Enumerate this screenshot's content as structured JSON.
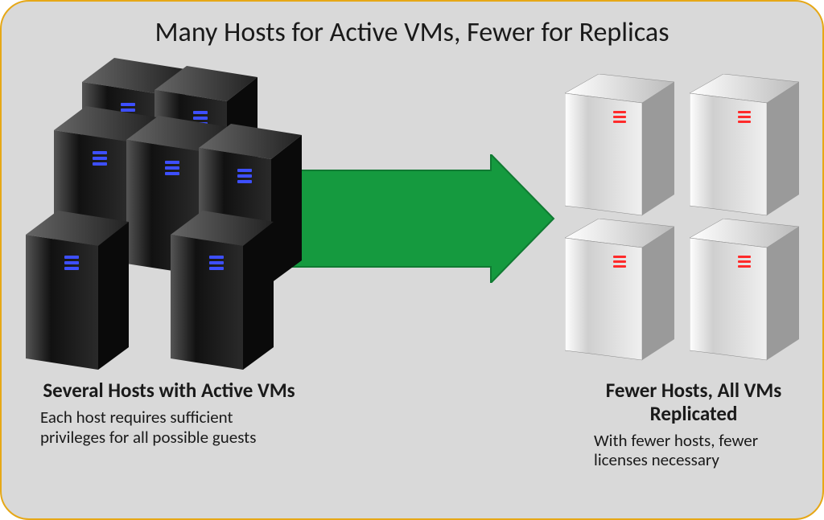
{
  "title": "Many Hosts for Active VMs, Fewer for Replicas",
  "left": {
    "heading": "Several Hosts with Active VMs",
    "sub": "Each host requires sufficient privileges for all possible guests"
  },
  "right": {
    "heading": "Fewer Hosts, All VMs Replicated",
    "sub": "With fewer hosts, fewer licenses necessary"
  },
  "colors": {
    "arrow_fill": "#159a3f",
    "arrow_stroke": "#107a32",
    "blue_led": "#3d4fff",
    "red_led": "#ff2b2b"
  },
  "counts": {
    "active_hosts": 7,
    "replica_hosts": 4
  }
}
